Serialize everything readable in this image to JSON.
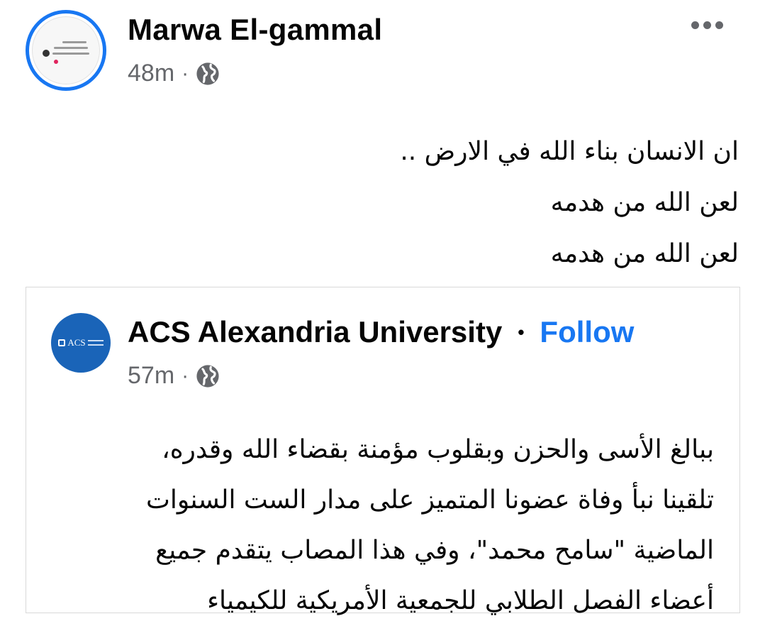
{
  "post": {
    "author": "Marwa El-gammal",
    "time": "48m",
    "separator": "·",
    "privacy_icon": "globe-icon",
    "more_icon": "more-horizontal-icon",
    "text_lines": [
      "ان الانسان بناء الله في الارض ..",
      "لعن الله من هدمه",
      "لعن الله من هدمه"
    ]
  },
  "shared": {
    "page_name": "ACS Alexandria University",
    "separator": "•",
    "follow_label": "Follow",
    "time": "57m",
    "meta_separator": "·",
    "privacy_icon": "globe-icon",
    "avatar_text": "ACS",
    "text_lines": [
      "ببالغ الأسى والحزن وبقلوب مؤمنة بقضاء الله وقدره،",
      "تلقينا نبأ وفاة عضونا المتميز على مدار الست السنوات",
      "الماضية \"سامح محمد\"، وفي هذا المصاب يتقدم جميع",
      "أعضاء الفصل الطلابي للجمعية الأمريكية للكيمياء"
    ]
  },
  "colors": {
    "accent": "#1877f2",
    "secondary_text": "#65676b",
    "page_avatar_bg": "#1a64b8"
  }
}
